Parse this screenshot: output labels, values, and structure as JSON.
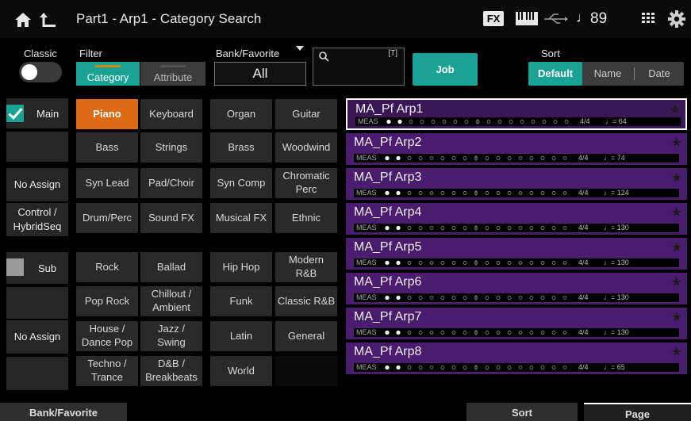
{
  "header": {
    "title": "Part1 - Arp1 - Category Search",
    "fx_label": "FX",
    "tempo": "89",
    "note_glyph": "♩"
  },
  "classic": {
    "label": "Classic",
    "on": false
  },
  "filter": {
    "label": "Filter",
    "tabs": [
      "Category",
      "Attribute"
    ],
    "selected": "Category"
  },
  "bank": {
    "label": "Bank/Favorite",
    "value": "All"
  },
  "search": {
    "value": "",
    "keyboard_hint": "[T]"
  },
  "job_label": "Job",
  "sort": {
    "label": "Sort",
    "options": [
      "Default",
      "Name",
      "Date"
    ],
    "selected": "Default"
  },
  "left_column": {
    "main_label": "Main",
    "main_checked": true,
    "sub_label": "Sub",
    "sub_checked": false,
    "no_assign_1": "No Assign",
    "control_hybrid": "Control /\nHybridSeq",
    "no_assign_2": "No Assign"
  },
  "main_categories": [
    [
      "Piano",
      "Keyboard",
      "Organ",
      "Guitar"
    ],
    [
      "Bass",
      "Strings",
      "Brass",
      "Woodwind"
    ],
    [
      "Syn Lead",
      "Pad/Choir",
      "Syn Comp",
      "Chromatic\nPerc"
    ],
    [
      "Drum/Perc",
      "Sound FX",
      "Musical FX",
      "Ethnic"
    ]
  ],
  "sub_categories": [
    [
      "Rock",
      "Ballad",
      "Hip Hop",
      "Modern\nR&B"
    ],
    [
      "Pop Rock",
      "Chillout /\nAmbient",
      "Funk",
      "Classic R&B"
    ],
    [
      "House /\nDance Pop",
      "Jazz /\nSwing",
      "Latin",
      "General"
    ],
    [
      "Techno /\nTrance",
      "D&B /\nBreakbeats",
      "World",
      ""
    ]
  ],
  "selected_category": "Piano",
  "results": [
    {
      "name": "MA_Pf Arp1",
      "sig": "4/4",
      "tempo": "♩= 64",
      "selected": true
    },
    {
      "name": "MA_Pf Arp2",
      "sig": "4/4",
      "tempo": "♩= 74",
      "selected": false
    },
    {
      "name": "MA_Pf Arp3",
      "sig": "4/4",
      "tempo": "♩= 124",
      "selected": false
    },
    {
      "name": "MA_Pf Arp4",
      "sig": "4/4",
      "tempo": "♩= 130",
      "selected": false
    },
    {
      "name": "MA_Pf Arp5",
      "sig": "4/4",
      "tempo": "♩= 130",
      "selected": false
    },
    {
      "name": "MA_Pf Arp6",
      "sig": "4/4",
      "tempo": "♩= 130",
      "selected": false
    },
    {
      "name": "MA_Pf Arp7",
      "sig": "4/4",
      "tempo": "♩= 130",
      "selected": false
    },
    {
      "name": "MA_Pf Arp8",
      "sig": "4/4",
      "tempo": "♩= 65",
      "selected": false
    }
  ],
  "meas_label": "MEAS",
  "bottom": {
    "bank_favorite": "Bank/Favorite",
    "sort": "Sort",
    "page": "Page"
  },
  "colors": {
    "accent": "#1aa394",
    "category_active": "#dd6a15",
    "result_bg": "#4a1c6e"
  },
  "icons": [
    "home-icon",
    "up-arrow-icon",
    "keyboard-icon",
    "usb-icon",
    "grid-icon",
    "gear-icon",
    "search-icon",
    "star-icon"
  ]
}
